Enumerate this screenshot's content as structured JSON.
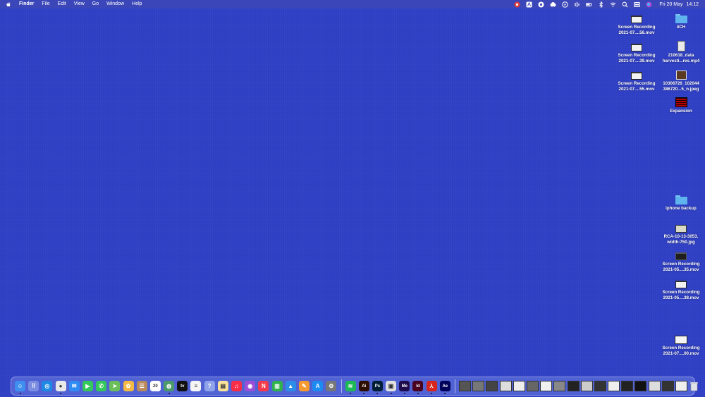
{
  "menubar": {
    "app_name": "Finder",
    "menus": [
      "File",
      "Edit",
      "View",
      "Go",
      "Window",
      "Help"
    ],
    "status_icons": [
      "record-icon",
      "text-icon",
      "chrome-icon",
      "creative-cloud-icon",
      "play-icon",
      "audio-icon",
      "battery-icon",
      "bluetooth-icon",
      "wifi-icon",
      "search-icon",
      "control-center-icon",
      "siri-icon"
    ],
    "date": "Fri 20 May",
    "time": "14:12"
  },
  "desktop": {
    "col1": [
      {
        "line1": "Screen Recording",
        "line2": "2021-07....56.mov",
        "kind": "mov"
      },
      {
        "line1": "Screen Recording",
        "line2": "2021-07....39.mov",
        "kind": "mov"
      },
      {
        "line1": "Screen Recording",
        "line2": "2021-07....55.mov",
        "kind": "mov"
      }
    ],
    "col2_top": [
      {
        "line1": "4CH",
        "line2": "",
        "kind": "folder"
      },
      {
        "line1": "210618_data",
        "line2": "harvesti...res.mp4",
        "kind": "doc"
      },
      {
        "line1": "10306726_102044",
        "line2": "386720...5_n.jpeg",
        "kind": "photo"
      },
      {
        "line1": "Expansion",
        "line2": "",
        "kind": "red"
      }
    ],
    "col2_bottom": [
      {
        "line1": "iphone backup",
        "line2": "",
        "kind": "folder"
      },
      {
        "line1": "RCA-10-13-3053.",
        "line2": "width-750.jpg",
        "kind": "img"
      },
      {
        "line1": "Screen Recording",
        "line2": "2021-05....35.mov",
        "kind": "mov-dark"
      },
      {
        "line1": "Screen Recording",
        "line2": "2021-05....38.mov",
        "kind": "mov"
      },
      {
        "line1": "Screen Recording",
        "line2": "2021-07....00.mov",
        "kind": "wide"
      }
    ]
  },
  "dock": {
    "apps": [
      {
        "name": "finder",
        "color": "#3f8ff0",
        "glyph": "☺",
        "running": true
      },
      {
        "name": "launchpad",
        "color": "#7a8de0",
        "glyph": "⠿",
        "running": false
      },
      {
        "name": "safari",
        "color": "#1e88e5",
        "glyph": "◎",
        "running": false
      },
      {
        "name": "chrome",
        "color": "#e8e8e8",
        "glyph": "●",
        "running": true
      },
      {
        "name": "mail",
        "color": "#2f8cf4",
        "glyph": "✉",
        "running": false
      },
      {
        "name": "facetime",
        "color": "#34c759",
        "glyph": "▶",
        "running": false
      },
      {
        "name": "messages",
        "color": "#34c759",
        "glyph": "✆",
        "running": false
      },
      {
        "name": "maps",
        "color": "#6bbf59",
        "glyph": "➤",
        "running": false
      },
      {
        "name": "photos",
        "color": "#f4b942",
        "glyph": "✿",
        "running": false
      },
      {
        "name": "contacts",
        "color": "#b98a5a",
        "glyph": "☰",
        "running": false
      },
      {
        "name": "calendar",
        "color": "#ffffff",
        "glyph": "20",
        "running": false
      },
      {
        "name": "earth",
        "color": "#4a9a6a",
        "glyph": "◍",
        "running": true
      },
      {
        "name": "apple-tv",
        "color": "#111111",
        "glyph": "tv",
        "running": false
      },
      {
        "name": "reminders",
        "color": "#f5f5f5",
        "glyph": "≡",
        "running": false
      },
      {
        "name": "help",
        "color": "#8fa3ea",
        "glyph": "?",
        "running": false
      },
      {
        "name": "notes",
        "color": "#fbe39a",
        "glyph": "▤",
        "running": false
      },
      {
        "name": "music",
        "color": "#fa2d48",
        "glyph": "♫",
        "running": false
      },
      {
        "name": "podcasts",
        "color": "#9b4fd8",
        "glyph": "◉",
        "running": false
      },
      {
        "name": "news",
        "color": "#f53b4b",
        "glyph": "N",
        "running": false
      },
      {
        "name": "numbers",
        "color": "#2fb24c",
        "glyph": "▥",
        "running": false
      },
      {
        "name": "keynote",
        "color": "#2c8ee8",
        "glyph": "▲",
        "running": false
      },
      {
        "name": "pages",
        "color": "#f59a2e",
        "glyph": "✎",
        "running": false
      },
      {
        "name": "app-store",
        "color": "#1d8cf2",
        "glyph": "A",
        "running": false
      },
      {
        "name": "system-preferences",
        "color": "#777777",
        "glyph": "⚙",
        "running": false
      }
    ],
    "apps2": [
      {
        "name": "spotify",
        "color": "#1db954",
        "glyph": "≋",
        "running": true
      },
      {
        "name": "illustrator",
        "color": "#2d0e00",
        "glyph": "Ai",
        "running": true
      },
      {
        "name": "photoshop",
        "color": "#001e36",
        "glyph": "Ps",
        "running": true
      },
      {
        "name": "preview",
        "color": "#e0e0e0",
        "glyph": "▣",
        "running": true
      },
      {
        "name": "media-encoder",
        "color": "#1d0b4e",
        "glyph": "Me",
        "running": true
      },
      {
        "name": "indesign",
        "color": "#49021f",
        "glyph": "Id",
        "running": true
      },
      {
        "name": "acrobat",
        "color": "#d7261e",
        "glyph": "⅄",
        "running": true
      },
      {
        "name": "after-effects",
        "color": "#00005b",
        "glyph": "Ae",
        "running": true
      }
    ],
    "minimized_count": 17
  }
}
